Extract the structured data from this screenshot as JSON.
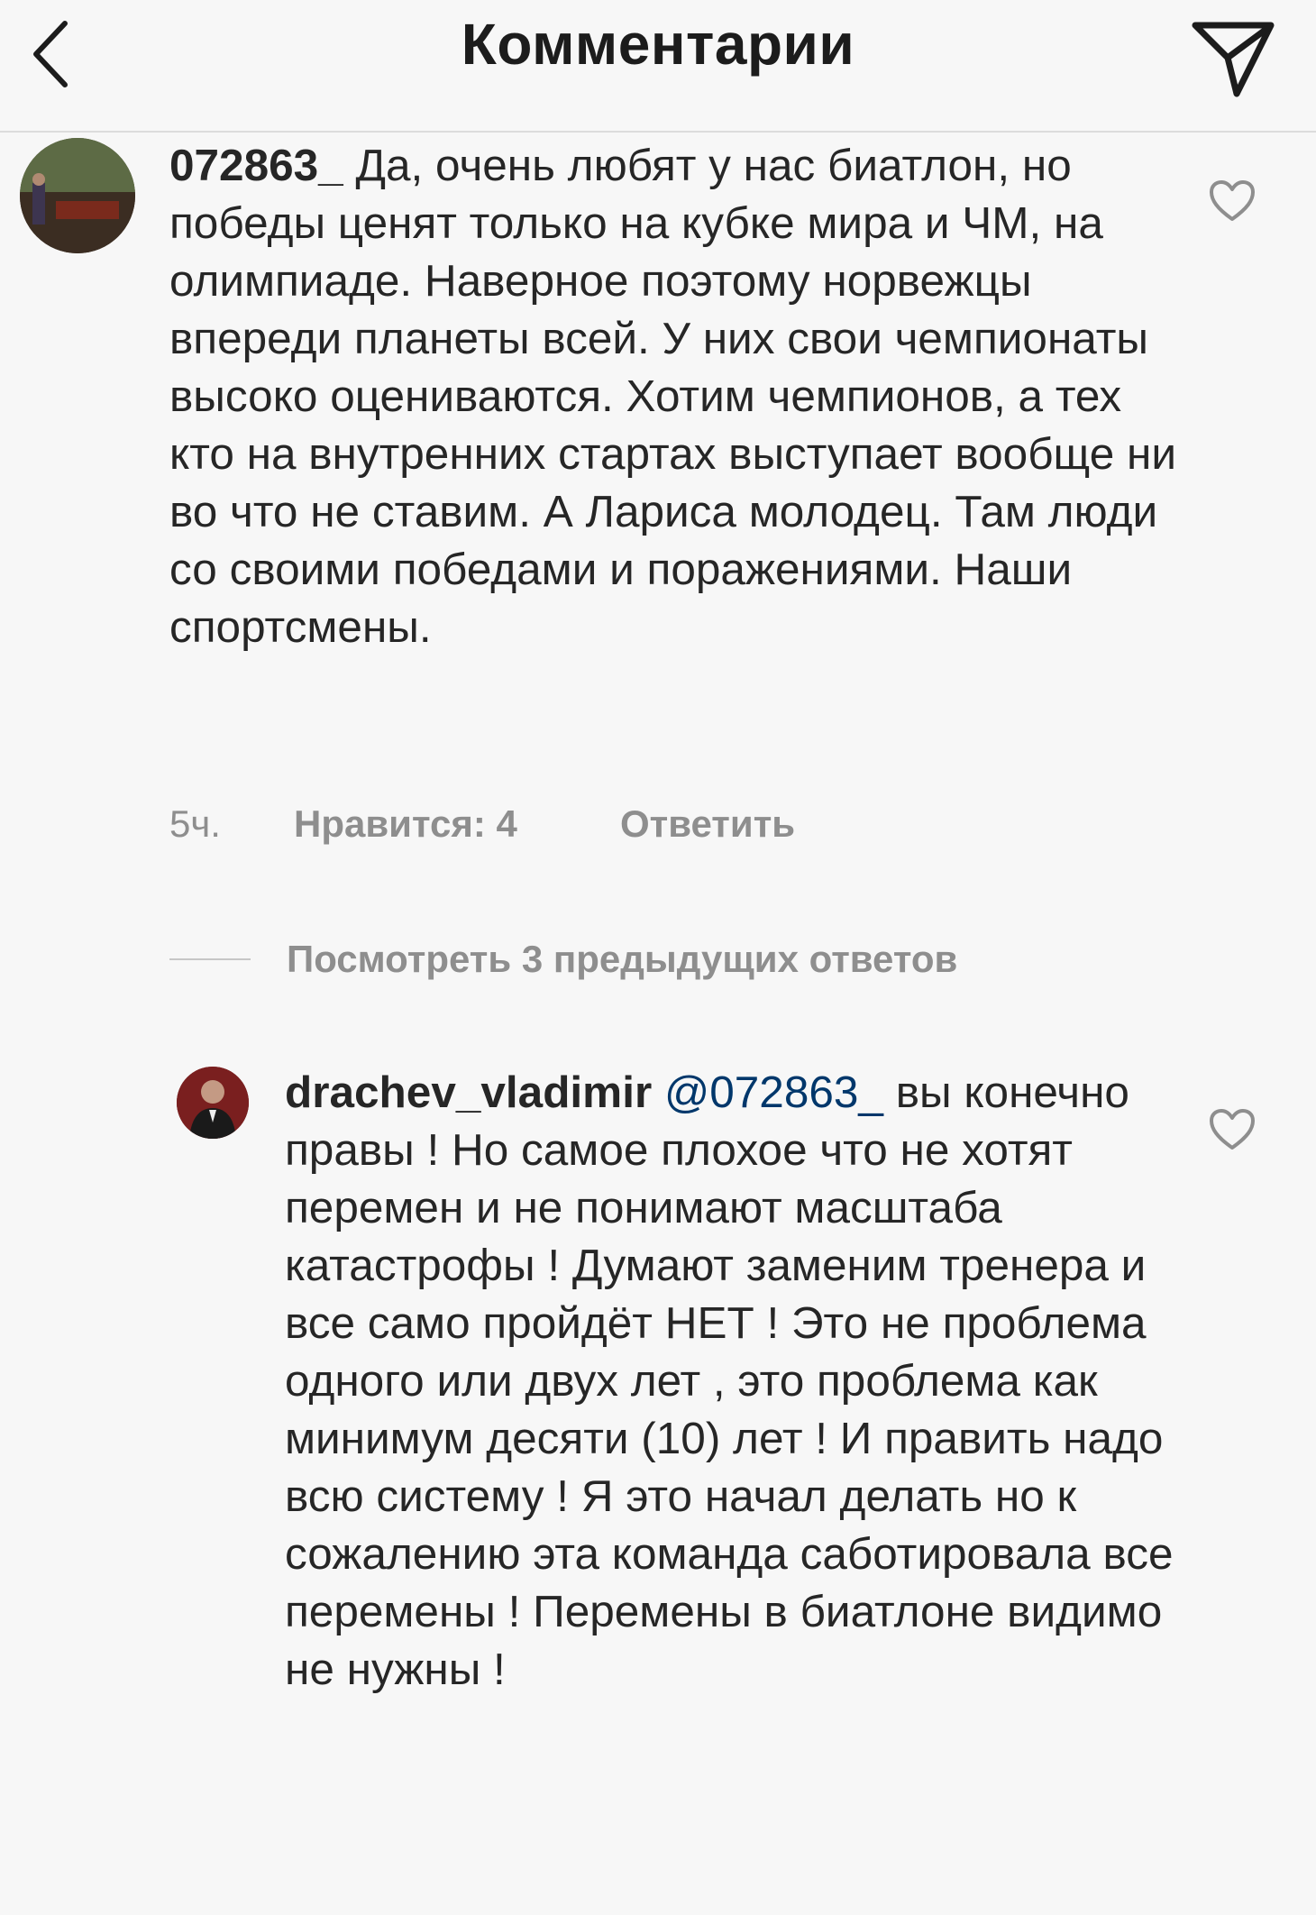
{
  "header": {
    "title": "Комментарии",
    "back_icon": "chevron-left-icon",
    "send_icon": "paper-plane-icon"
  },
  "comments": [
    {
      "username": "072863_",
      "text": "Да, очень любят у нас биатлон, но победы ценят только на кубке мира и ЧМ, на олимпиаде. Наверное поэтому норвежцы впереди планеты всей. У них свои чемпионаты высоко оцениваются. Хотим чемпионов, а тех кто на внутренних стартах выступает вообще ни во что не ставим. А Лариса молодец. Там люди со своими победами и поражениями. Наши спортсмены.",
      "time": "5ч.",
      "likes": "Нравится: 4",
      "reply": "Ответить"
    }
  ],
  "view_replies": "Посмотреть 3 предыдущих ответов",
  "replies": [
    {
      "username": "drachev_vladimir",
      "mention": "@072863_",
      "text": "вы конечно правы ! Но самое плохое что не хотят перемен и не понимают масштаба катастрофы ! Думают заменим тренера и все само пройдёт НЕТ ! Это не проблема одного или двух лет , это проблема как минимум десяти (10) лет ! И править надо всю систему ! Я это начал делать но к сожалению эта команда саботировала все перемены ! Перемены в биатлоне видимо не нужны !"
    }
  ],
  "colors": {
    "background": "#f7f7f7",
    "text": "#262626",
    "secondary": "#8e8e8e",
    "mention": "#00376b"
  }
}
